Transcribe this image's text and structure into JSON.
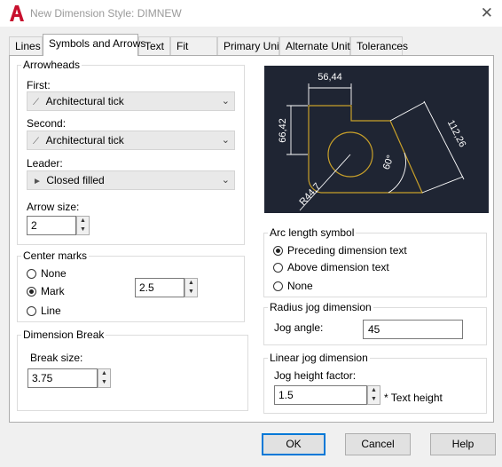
{
  "window": {
    "title": "New Dimension Style: DIMNEW",
    "close_glyph": "✕"
  },
  "tabs": [
    {
      "label": "Lines"
    },
    {
      "label": "Symbols and Arrows",
      "active": true
    },
    {
      "label": "Text"
    },
    {
      "label": "Fit"
    },
    {
      "label": "Primary Units"
    },
    {
      "label": "Alternate Units"
    },
    {
      "label": "Tolerances"
    }
  ],
  "arrowheads": {
    "title": "Arrowheads",
    "first_label": "First:",
    "first_value": "Architectural tick",
    "second_label": "Second:",
    "second_value": "Architectural tick",
    "leader_label": "Leader:",
    "leader_value": "Closed filled",
    "arrow_size_label": "Arrow size:",
    "arrow_size_value": "2"
  },
  "center_marks": {
    "title": "Center marks",
    "options": [
      "None",
      "Mark",
      "Line"
    ],
    "selected": "Mark",
    "size_value": "2.5"
  },
  "dimension_break": {
    "title": "Dimension Break",
    "break_size_label": "Break size:",
    "break_size_value": "3.75"
  },
  "preview": {
    "dim_top": "56,44",
    "dim_left": "66,42",
    "dim_slant": "112,26",
    "dim_angle": "60°",
    "dim_radius": "R44,7"
  },
  "arc_length_symbol": {
    "title": "Arc length symbol",
    "options": [
      "Preceding dimension text",
      "Above dimension text",
      "None"
    ],
    "selected": "Preceding dimension text"
  },
  "radius_jog": {
    "title": "Radius jog dimension",
    "jog_angle_label": "Jog angle:",
    "jog_angle_value": "45"
  },
  "linear_jog": {
    "title": "Linear jog dimension",
    "height_factor_label": "Jog height factor:",
    "height_factor_value": "1.5",
    "height_suffix": "* Text height"
  },
  "buttons": {
    "ok": "OK",
    "cancel": "Cancel",
    "help": "Help"
  },
  "colors": {
    "preview_bg": "#1f2533",
    "geometry": "#c8a02a",
    "dimensions": "#ffffff",
    "accent": "#0078d7",
    "app_icon": "#c8102e"
  }
}
